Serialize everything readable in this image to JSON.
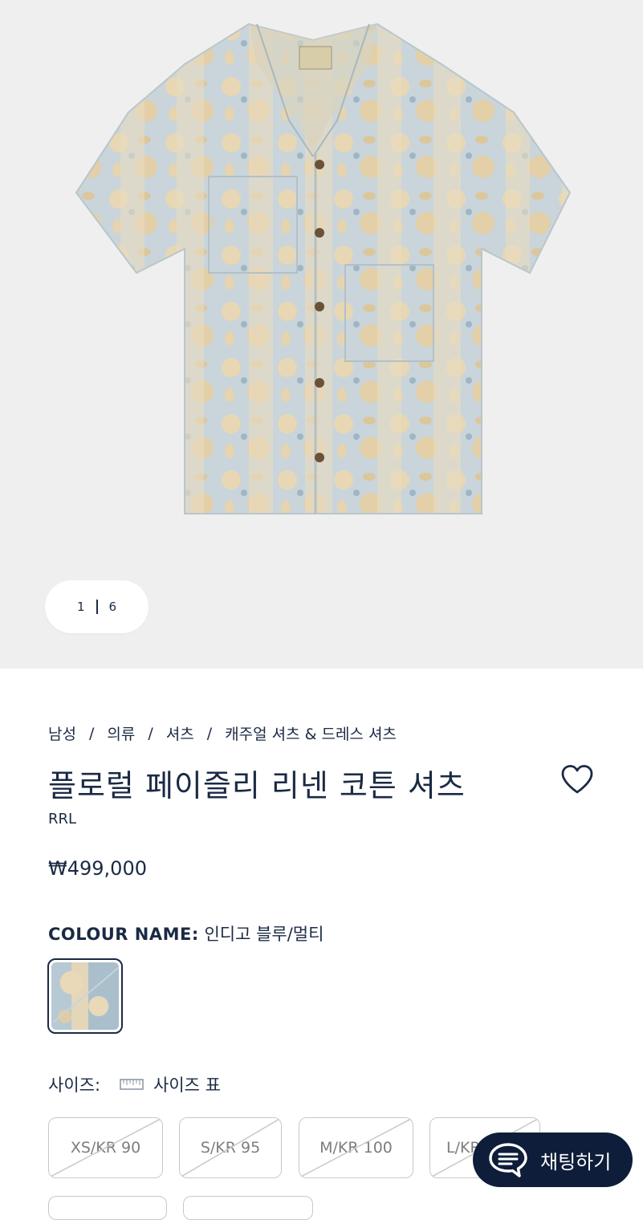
{
  "gallery": {
    "pager": {
      "current": "1",
      "total": "6"
    }
  },
  "breadcrumb": [
    "남성",
    "의류",
    "셔츠",
    "캐주얼 셔츠 & 드레스 셔츠"
  ],
  "breadcrumb_separator": "/",
  "product": {
    "title": "플로럴 페이즐리 리넨 코튼 셔츠",
    "brand": "RRL",
    "price": "₩499,000"
  },
  "colour": {
    "label": "COLOUR NAME:",
    "value": "인디고 블루/멀티"
  },
  "size": {
    "label": "사이즈:",
    "chart_label": "사이즈 표",
    "options": [
      {
        "label": "XS/KR 90",
        "available": false
      },
      {
        "label": "S/KR 95",
        "available": false
      },
      {
        "label": "M/KR 100",
        "available": false
      },
      {
        "label": "L/KR 105",
        "available": false
      }
    ]
  },
  "chat": {
    "label": "채팅하기"
  },
  "icons": {
    "wishlist": "heart-outline-icon",
    "size_chart": "ruler-icon",
    "chat": "chat-bubble-icon"
  },
  "colors": {
    "navy": "#1b2a44",
    "chat_bg": "#0d1d3a",
    "gallery_bg": "#efefef"
  }
}
